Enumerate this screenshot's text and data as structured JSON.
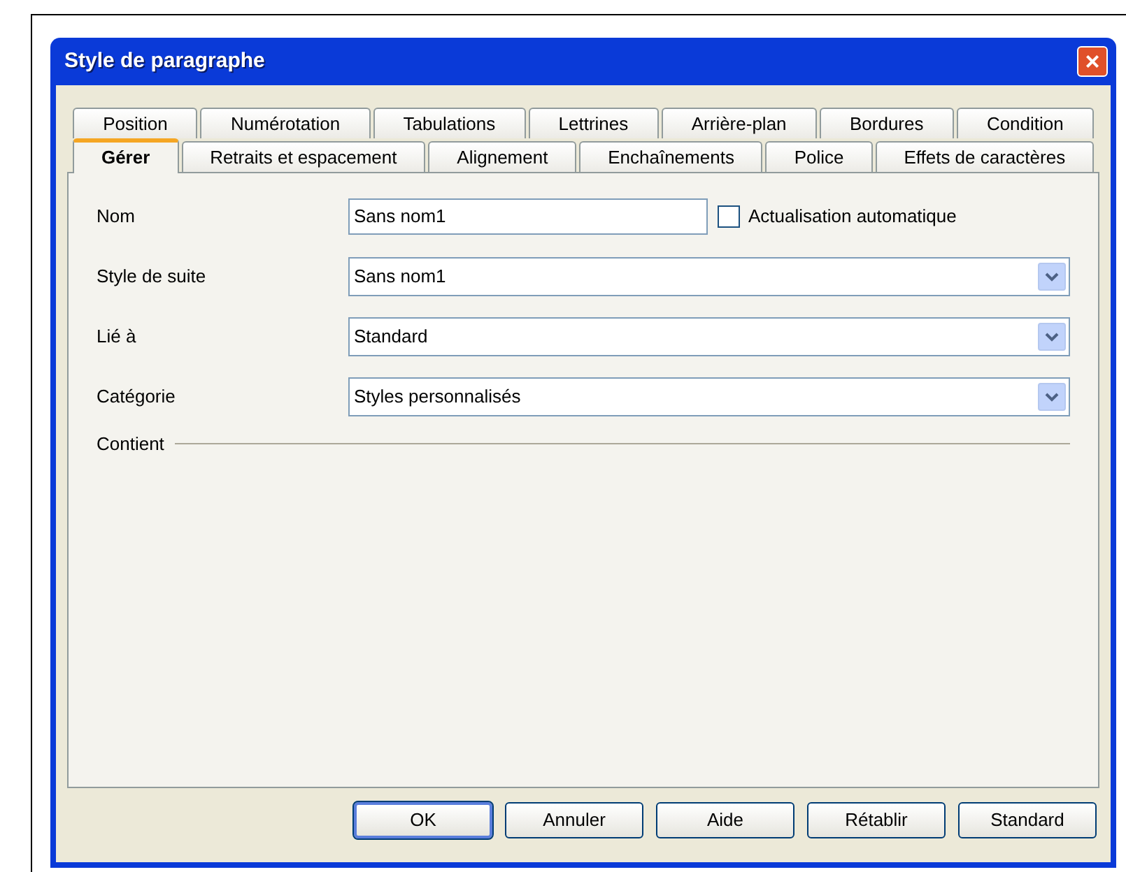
{
  "window": {
    "title": "Style de paragraphe",
    "close": "×"
  },
  "tabs": [
    [
      {
        "label": "Position",
        "selected": false
      },
      {
        "label": "Numérotation",
        "selected": false
      },
      {
        "label": "Tabulations",
        "selected": false
      },
      {
        "label": "Lettrines",
        "selected": false
      },
      {
        "label": "Arrière-plan",
        "selected": false
      },
      {
        "label": "Bordures",
        "selected": false
      },
      {
        "label": "Condition",
        "selected": false
      }
    ],
    [
      {
        "label": "Gérer",
        "selected": true
      },
      {
        "label": "Retraits et espacement",
        "selected": false
      },
      {
        "label": "Alignement",
        "selected": false
      },
      {
        "label": "Enchaînements",
        "selected": false
      },
      {
        "label": "Police",
        "selected": false
      },
      {
        "label": "Effets de caractères",
        "selected": false
      }
    ]
  ],
  "form": {
    "fields": [
      {
        "kind": "text",
        "label": "Nom",
        "value": "Sans nom1",
        "checkbox": {
          "label": "Actualisation automatique",
          "checked": false
        }
      },
      {
        "kind": "combo",
        "label": "Style de suite",
        "value": "Sans nom1"
      },
      {
        "kind": "combo",
        "label": "Lié à",
        "value": "Standard"
      },
      {
        "kind": "combo",
        "label": "Catégorie",
        "value": "Styles personnalisés"
      }
    ],
    "section": "Contient"
  },
  "buttons": [
    {
      "label": "OK",
      "default": true
    },
    {
      "label": "Annuler",
      "default": false
    },
    {
      "label": "Aide",
      "default": false
    },
    {
      "label": "Rétablir",
      "default": false
    },
    {
      "label": "Standard",
      "default": false
    }
  ]
}
